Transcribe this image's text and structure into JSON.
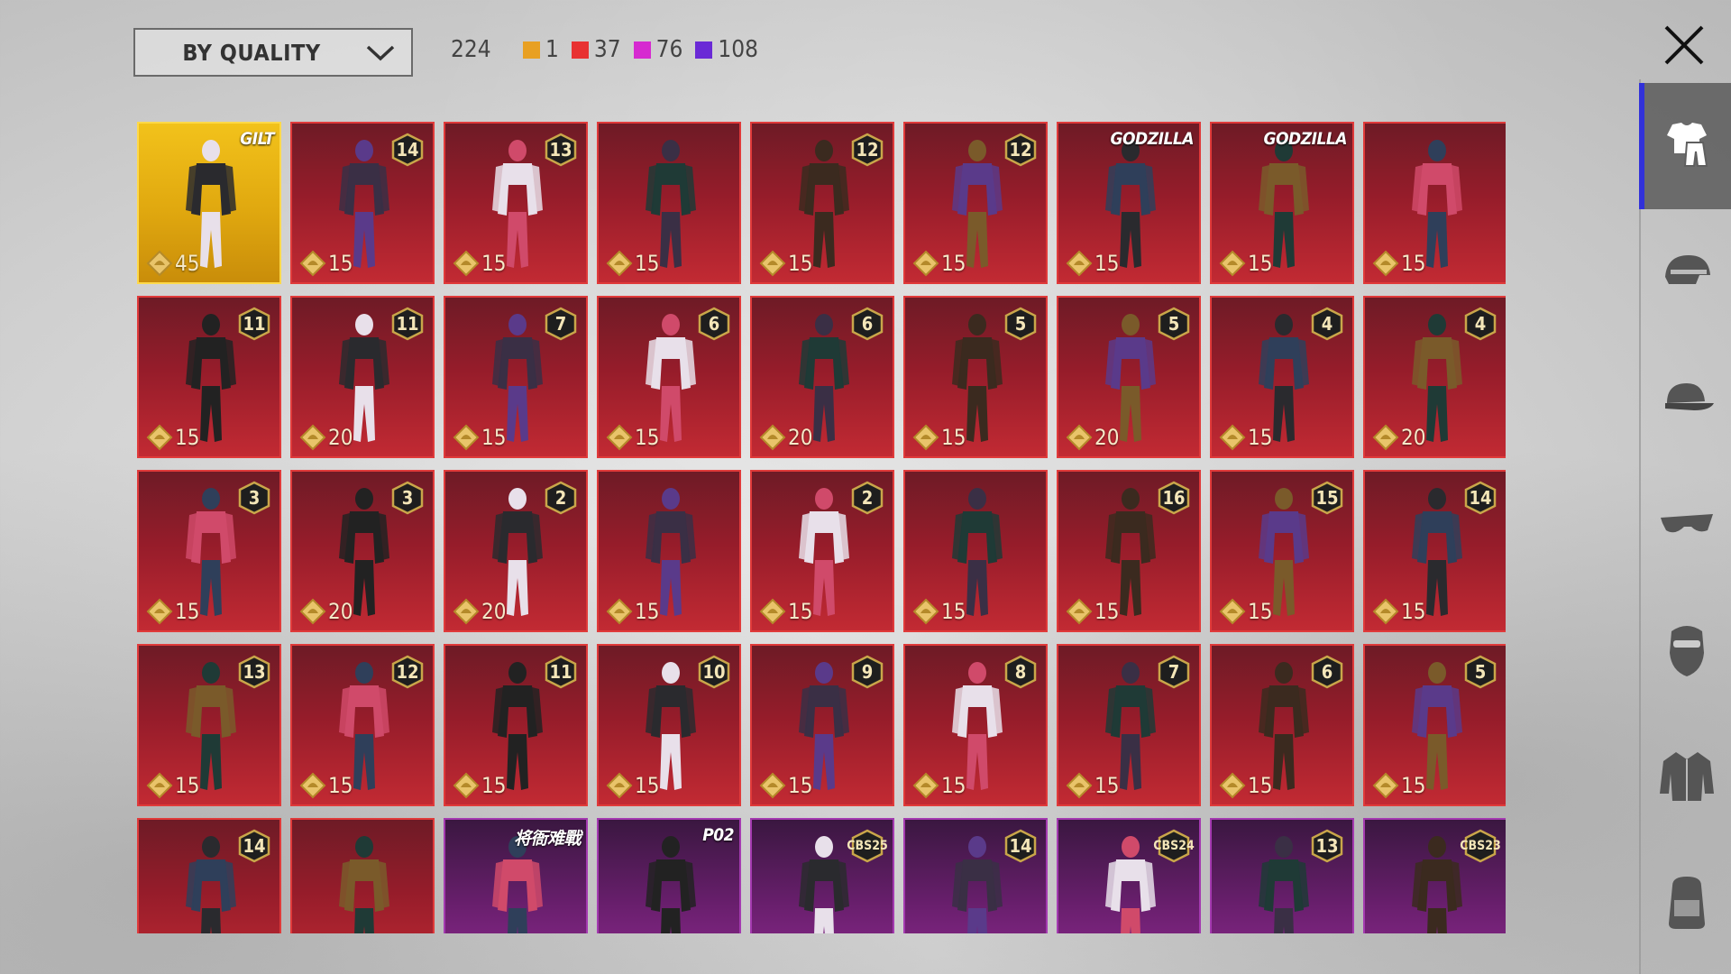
{
  "header": {
    "sort_label": "BY QUALITY",
    "total": "224",
    "counts": [
      {
        "color": "#e8a023",
        "value": "1"
      },
      {
        "color": "#e83232",
        "value": "37"
      },
      {
        "color": "#d62ad0",
        "value": "76"
      },
      {
        "color": "#6a2ad6",
        "value": "108"
      }
    ]
  },
  "sidebar": {
    "tabs": [
      {
        "icon": "outfit-icon",
        "active": true
      },
      {
        "icon": "helmet-icon",
        "active": false
      },
      {
        "icon": "cap-icon",
        "active": false
      },
      {
        "icon": "glasses-icon",
        "active": false
      },
      {
        "icon": "mask-icon",
        "active": false
      },
      {
        "icon": "jacket-icon",
        "active": false
      },
      {
        "icon": "backpack-icon",
        "active": false
      }
    ]
  },
  "items": [
    {
      "quality": "gold",
      "price": "45",
      "logo": "GILT"
    },
    {
      "quality": "red",
      "price": "15",
      "rank": "14"
    },
    {
      "quality": "red",
      "price": "15",
      "rank": "13"
    },
    {
      "quality": "red",
      "price": "15"
    },
    {
      "quality": "red",
      "price": "15",
      "rank": "12"
    },
    {
      "quality": "red",
      "price": "15",
      "rank": "12"
    },
    {
      "quality": "red",
      "price": "15",
      "logo": "GODZILLA"
    },
    {
      "quality": "red",
      "price": "15",
      "logo": "GODZILLA"
    },
    {
      "quality": "red",
      "price": "15"
    },
    {
      "quality": "red",
      "price": "15",
      "rank": "11"
    },
    {
      "quality": "red",
      "price": "20",
      "rank": "11"
    },
    {
      "quality": "red",
      "price": "15",
      "rank": "7"
    },
    {
      "quality": "red",
      "price": "15",
      "rank": "6"
    },
    {
      "quality": "red",
      "price": "20",
      "rank": "6"
    },
    {
      "quality": "red",
      "price": "15",
      "rank": "5"
    },
    {
      "quality": "red",
      "price": "20",
      "rank": "5"
    },
    {
      "quality": "red",
      "price": "15",
      "rank": "4"
    },
    {
      "quality": "red",
      "price": "20",
      "rank": "4"
    },
    {
      "quality": "red",
      "price": "15",
      "rank": "3"
    },
    {
      "quality": "red",
      "price": "20",
      "rank": "3"
    },
    {
      "quality": "red",
      "price": "20",
      "rank": "2"
    },
    {
      "quality": "red",
      "price": "15"
    },
    {
      "quality": "red",
      "price": "15",
      "rank": "2"
    },
    {
      "quality": "red",
      "price": "15"
    },
    {
      "quality": "red",
      "price": "15",
      "rank": "16"
    },
    {
      "quality": "red",
      "price": "15",
      "rank": "15"
    },
    {
      "quality": "red",
      "price": "15",
      "rank": "14"
    },
    {
      "quality": "red",
      "price": "15",
      "rank": "13"
    },
    {
      "quality": "red",
      "price": "15",
      "rank": "12"
    },
    {
      "quality": "red",
      "price": "15",
      "rank": "11"
    },
    {
      "quality": "red",
      "price": "15",
      "rank": "10"
    },
    {
      "quality": "red",
      "price": "15",
      "rank": "9"
    },
    {
      "quality": "red",
      "price": "15",
      "rank": "8"
    },
    {
      "quality": "red",
      "price": "15",
      "rank": "7"
    },
    {
      "quality": "red",
      "price": "15",
      "rank": "6"
    },
    {
      "quality": "red",
      "price": "15",
      "rank": "5"
    },
    {
      "quality": "red",
      "rank": "14"
    },
    {
      "quality": "red"
    },
    {
      "quality": "purple",
      "logo": "将衙难戰"
    },
    {
      "quality": "purple",
      "logo": "P02"
    },
    {
      "quality": "purple",
      "rank": "CBS25"
    },
    {
      "quality": "purple",
      "rank": "14"
    },
    {
      "quality": "purple",
      "rank": "CBS24"
    },
    {
      "quality": "purple",
      "rank": "13"
    },
    {
      "quality": "purple",
      "rank": "CBS23"
    }
  ]
}
